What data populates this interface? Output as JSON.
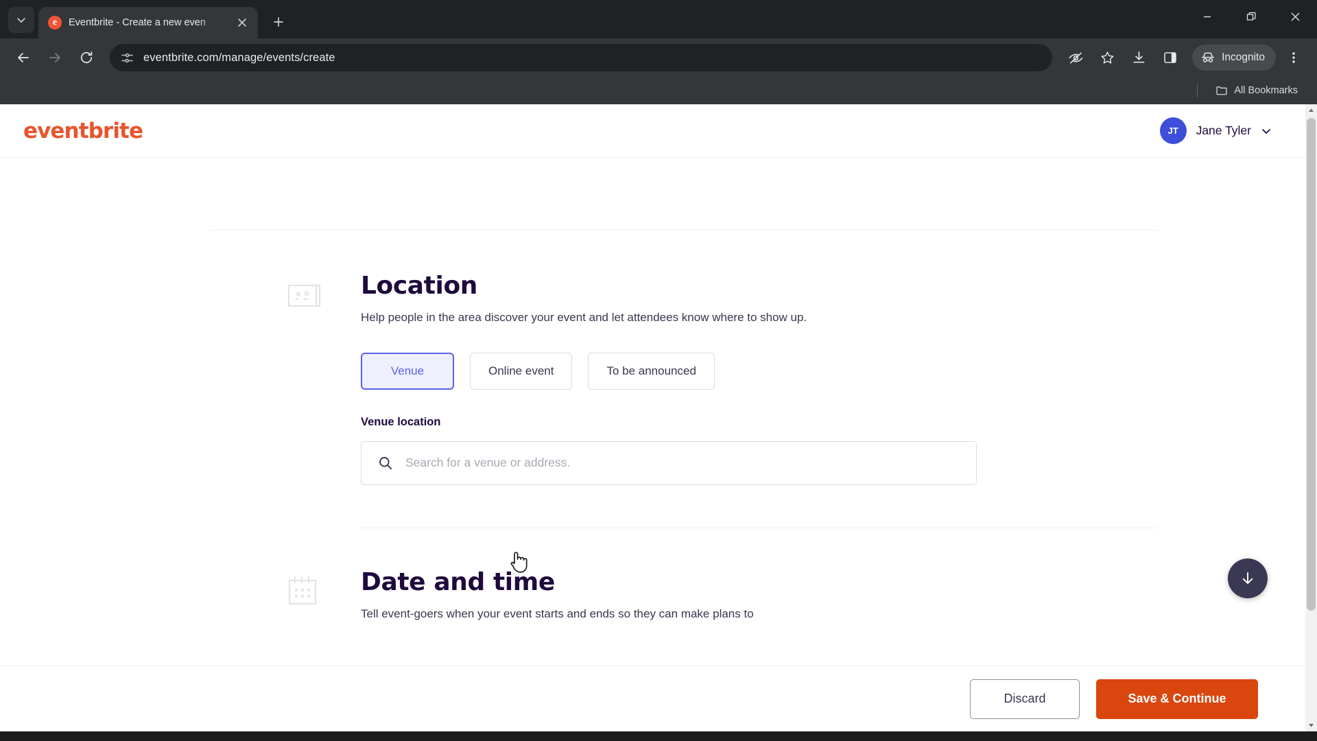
{
  "browser": {
    "tab": {
      "title": "Eventbrite - Create a new even",
      "favicon_letter": "e",
      "favicon_name": "eventbrite-favicon"
    },
    "url": "eventbrite.com/manage/events/create",
    "incognito_label": "Incognito",
    "bookmarks_label": "All Bookmarks",
    "icons": {
      "tab_search": "chevron-down-icon",
      "new_tab": "plus-icon",
      "close_tab": "close-icon",
      "back": "back-arrow-icon",
      "forward": "forward-arrow-icon",
      "reload": "reload-icon",
      "site_info": "page-settings-icon",
      "tracking": "eye-slash-icon",
      "bookmark": "star-icon",
      "downloads": "download-icon",
      "side_panel": "side-panel-icon",
      "incognito": "incognito-hat-icon",
      "menu": "three-dot-menu-icon",
      "minimize": "minimize-icon",
      "maximize": "restore-window-icon",
      "window_close": "window-close-icon",
      "bookmarks_folder": "folder-icon"
    }
  },
  "header": {
    "logo": "eventbrite",
    "user_name": "Jane Tyler",
    "user_initials": "JT",
    "chevron": "chevron-down-icon"
  },
  "location_section": {
    "icon": "map-blueprint-icon",
    "title": "Location",
    "description": "Help people in the area discover your event and let attendees know where to show up.",
    "choices": [
      {
        "label": "Venue",
        "selected": true
      },
      {
        "label": "Online event",
        "selected": false
      },
      {
        "label": "To be announced",
        "selected": false
      }
    ],
    "venue_field": {
      "label": "Venue location",
      "placeholder": "Search for a venue or address.",
      "value": "",
      "icon": "search-icon"
    }
  },
  "datetime_section": {
    "icon": "calendar-icon",
    "title": "Date and time",
    "description": "Tell event-goers when your event starts and ends so they can make plans to"
  },
  "footer": {
    "discard_label": "Discard",
    "save_label": "Save & Continue"
  },
  "overlays": {
    "scroll_down_icon": "arrow-down-icon",
    "cursor": "pointer-hand-cursor"
  },
  "colors": {
    "brand_orange": "#e8552d",
    "save_button": "#d9470e",
    "accent_blue": "#5a63e6",
    "avatar_blue": "#3d4ed8",
    "heading_navy": "#1e0a3c"
  }
}
